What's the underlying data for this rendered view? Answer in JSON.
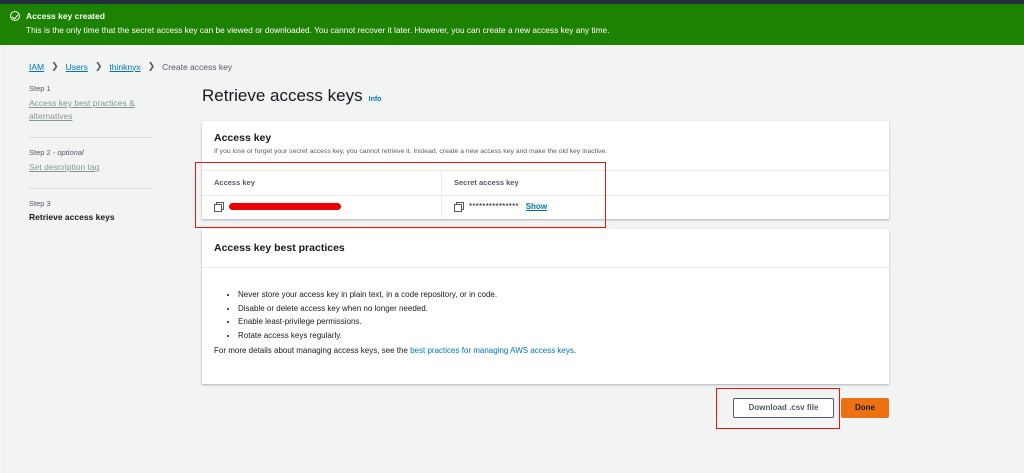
{
  "flash": {
    "title": "Access key created",
    "message": "This is the only time that the secret access key can be viewed or downloaded. You cannot recover it later. However, you can create a new access key any time."
  },
  "breadcrumb": [
    "IAM",
    "Users",
    "thinknyx",
    "Create access key"
  ],
  "steps": [
    {
      "num": "Step 1",
      "label": "Access key best practices & alternatives"
    },
    {
      "num": "Step 2",
      "optional": "optional",
      "label": "Set description tag"
    },
    {
      "num": "Step 3",
      "label": "Retrieve access keys"
    }
  ],
  "page": {
    "title": "Retrieve access keys",
    "info": "Info"
  },
  "access_key_panel": {
    "header": "Access key",
    "description": "If you lose or forget your secret access key, you cannot retrieve it. Instead, create a new access key and make the old key inactive.",
    "col1_label": "Access key",
    "col2_label": "Secret access key",
    "secret_masked": "***************",
    "show_link": "Show"
  },
  "best_practices_panel": {
    "header": "Access key best practices",
    "bullets": [
      "Never store your access key in plain text, in a code repository, or in code.",
      "Disable or delete access key when no longer needed.",
      "Enable least-privilege permissions.",
      "Rotate access keys regularly."
    ],
    "more_prefix": "For more details about managing access keys, see the ",
    "more_link": "best practices for managing AWS access keys",
    "more_suffix": "."
  },
  "buttons": {
    "download": "Download .csv file",
    "done": "Done"
  },
  "colors": {
    "flash_bg": "#1d8102",
    "link": "#0073bb",
    "primary": "#ec7211",
    "highlight": "#e11111"
  }
}
